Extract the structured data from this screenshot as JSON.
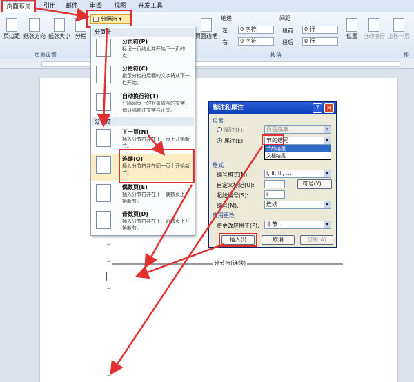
{
  "tabs": [
    "页面布局",
    "引用",
    "邮件",
    "审阅",
    "视图",
    "开发工具"
  ],
  "ribbon": {
    "buttons": [
      "页边距",
      "纸张方向",
      "纸张大小",
      "分栏"
    ],
    "breaks_button": "分隔符",
    "page_border": "页面边框",
    "group_page_setup": "页面设置",
    "indent_label": "缩进",
    "spacing_label": "间距",
    "left_label": "左",
    "right_label": "右",
    "before_label": "段前",
    "after_label": "段后",
    "indent_left_value": "0 字符",
    "indent_right_value": "0 字符",
    "space_before_value": "0 行",
    "space_after_value": "0 行",
    "group_paragraph": "段落",
    "position": "位置",
    "wrap": "自动换行",
    "bring_forward": "上移一层",
    "arrange": "排"
  },
  "breaks_menu": {
    "page_breaks_header": "分页符",
    "section_breaks_header": "分节符",
    "items": [
      {
        "title": "分页符(P)",
        "desc": "标记一页终止并开始下一页的点。"
      },
      {
        "title": "分栏符(C)",
        "desc": "指示分栏符后面的文字将从下一栏开始。"
      },
      {
        "title": "自动换行符(T)",
        "desc": "分隔网页上的对象周围的文字，如分隔题注文字与正文。"
      },
      {
        "title": "下一页(N)",
        "desc": "插入分节符并在下一页上开始新节。"
      },
      {
        "title": "连续(O)",
        "desc": "插入分节符并在同一页上开始新节。"
      },
      {
        "title": "偶数页(E)",
        "desc": "插入分节符并在下一偶数页上开始新节。"
      },
      {
        "title": "奇数页(D)",
        "desc": "插入分节符并在下一奇数页上开始新节。"
      }
    ]
  },
  "dialog": {
    "title": "脚注和尾注",
    "position_label": "位置",
    "footnote_label": "脚注(F):",
    "footnote_value": "页面底端",
    "endnote_label": "尾注(E):",
    "endnote_value": "节的结尾",
    "dropdown_options": [
      "节的结尾",
      "文档结尾"
    ],
    "format_label": "格式",
    "number_format_label": "编号格式(N):",
    "number_format_value": "i, ii, iii, …",
    "custom_mark_label": "自定义标记(U):",
    "symbol_button": "符号(Y)...",
    "start_at_label": "起始编号(S):",
    "start_at_value": "i",
    "numbering_label": "编号(M):",
    "numbering_value": "连续",
    "apply_label": "应用更改",
    "apply_to_label": "将更改应用于(P):",
    "apply_to_value": "本节",
    "insert_button": "插入(I)",
    "cancel_button": "取消",
    "apply_button": "应用(A)"
  },
  "document": {
    "section_break_text": "分节符(连续)",
    "para_mark": "↵"
  },
  "colors": {
    "annotation_red": "#e03030"
  }
}
